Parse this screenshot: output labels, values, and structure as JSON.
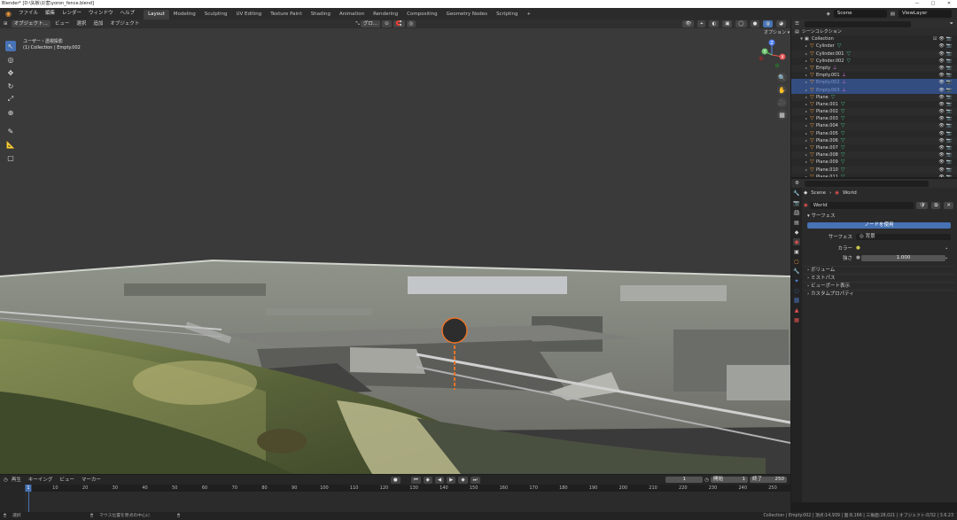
{
  "window": {
    "title": "Blender* [D:\\矢板\\災害\\yoron_fence.blend]",
    "controls": [
      "—",
      "□",
      "✕"
    ]
  },
  "menu": [
    "ファイル",
    "編集",
    "レンダー",
    "ウィンドウ",
    "ヘルプ"
  ],
  "workspaces": [
    "Layout",
    "Modeling",
    "Sculpting",
    "UV Editing",
    "Texture Paint",
    "Shading",
    "Animation",
    "Rendering",
    "Compositing",
    "Geometry Nodes",
    "Scripting",
    "+"
  ],
  "active_workspace": "Layout",
  "scene": {
    "scene_name": "Scene",
    "view_layer": "ViewLayer"
  },
  "viewport": {
    "mode": "オブジェクト...",
    "header_menus": [
      "ビュー",
      "選択",
      "追加",
      "オブジェクト"
    ],
    "transform_orientation": "グロ...",
    "view_name": "ユーザー・透視投影",
    "view_info": "(1) Collection | Empty.002",
    "options_label": "オプション ▾"
  },
  "gizmo_axes": {
    "x": "X",
    "y": "Y",
    "z": "Z"
  },
  "outliner": {
    "header_label": "シーンコレクション",
    "collection": "Collection",
    "items": [
      {
        "name": "Cylinder",
        "type": "mesh",
        "selected": false
      },
      {
        "name": "Cylinder.001",
        "type": "mesh",
        "selected": false
      },
      {
        "name": "Cylinder.002",
        "type": "mesh",
        "selected": false
      },
      {
        "name": "Empty",
        "type": "empty",
        "selected": false
      },
      {
        "name": "Empty.001",
        "type": "empty",
        "selected": false
      },
      {
        "name": "Empty.002",
        "type": "empty",
        "selected": true
      },
      {
        "name": "Empty.003",
        "type": "empty",
        "selected": true
      },
      {
        "name": "Plane",
        "type": "mesh",
        "selected": false
      },
      {
        "name": "Plane.001",
        "type": "mesh",
        "selected": false
      },
      {
        "name": "Plane.002",
        "type": "mesh",
        "selected": false
      },
      {
        "name": "Plane.003",
        "type": "mesh",
        "selected": false
      },
      {
        "name": "Plane.004",
        "type": "mesh",
        "selected": false
      },
      {
        "name": "Plane.005",
        "type": "mesh",
        "selected": false
      },
      {
        "name": "Plane.006",
        "type": "mesh",
        "selected": false
      },
      {
        "name": "Plane.007",
        "type": "mesh",
        "selected": false
      },
      {
        "name": "Plane.008",
        "type": "mesh",
        "selected": false
      },
      {
        "name": "Plane.009",
        "type": "mesh",
        "selected": false
      },
      {
        "name": "Plane.010",
        "type": "mesh",
        "selected": false
      },
      {
        "name": "Plane.011",
        "type": "mesh",
        "selected": false
      }
    ]
  },
  "properties": {
    "breadcrumb_scene": "Scene",
    "breadcrumb_world": "World",
    "world_name": "World",
    "surface_panel": "サーフェス",
    "use_nodes_button": "ノードを使用",
    "surface_label": "サーフェス",
    "surface_value": "背景",
    "color_label": "カラー",
    "strength_label": "強さ",
    "strength_value": "1.000",
    "panels": [
      "ボリューム",
      "ミストパス",
      "ビューポート表示",
      "カスタムプロパティ"
    ]
  },
  "timeline": {
    "menus": [
      "再生",
      "キーイング",
      "ビュー",
      "マーカー"
    ],
    "current_frame": "1",
    "start_label": "開始",
    "start_value": "1",
    "end_label": "終了",
    "end_value": "250",
    "ticks": [
      "1",
      "10",
      "20",
      "30",
      "40",
      "50",
      "60",
      "70",
      "80",
      "90",
      "100",
      "110",
      "120",
      "130",
      "140",
      "150",
      "160",
      "170",
      "180",
      "190",
      "200",
      "210",
      "220",
      "230",
      "240",
      "250"
    ]
  },
  "status": {
    "left_hint": "選択",
    "mid_hint": "マウス位置を原点の中心に",
    "right_info": "Collection | Empty.002 | 頂点:14,939 | 面:8,166 | 三角面:28,021 | オブジェクト:0/32 | 3.6.23"
  },
  "colors": {
    "accent": "#4772b3",
    "selection": "#334d80",
    "object_orange": "#e8973a",
    "mesh_green": "#47b47d"
  }
}
